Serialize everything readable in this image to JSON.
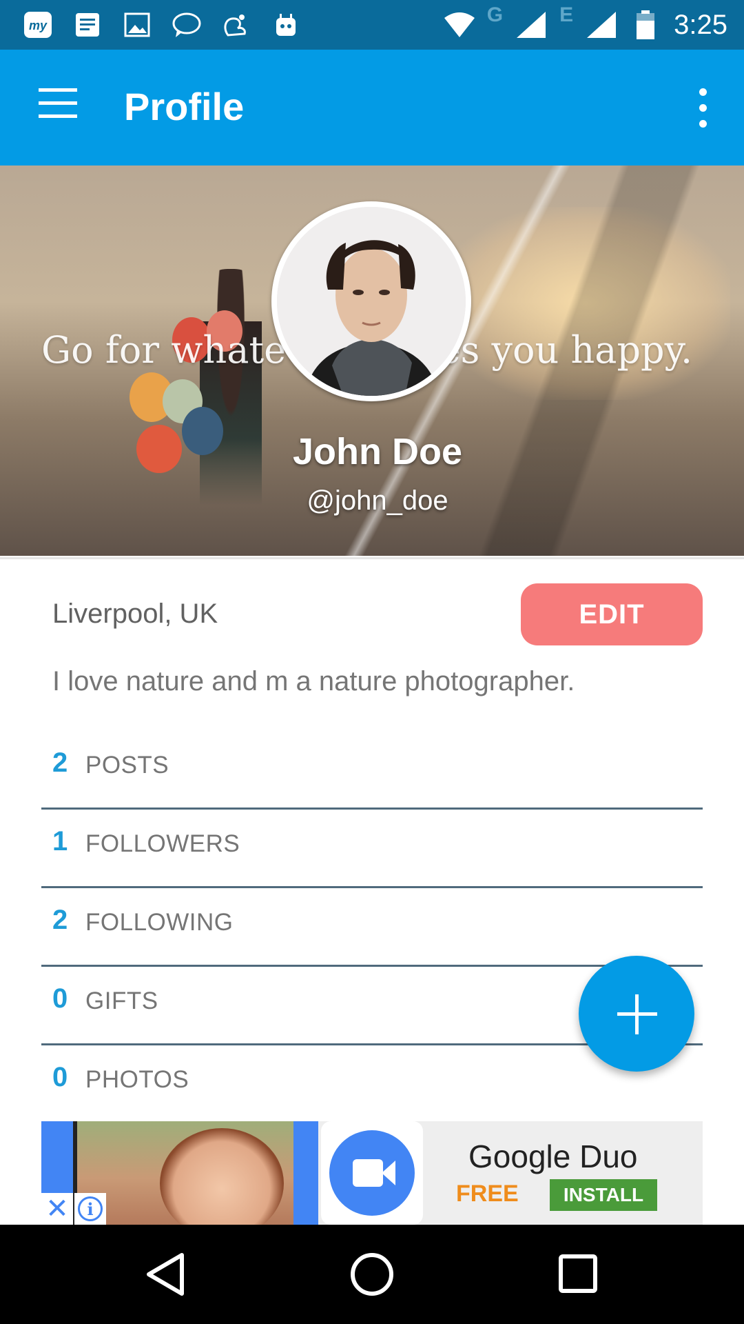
{
  "status_bar": {
    "time": "3:25",
    "network_1": "G",
    "network_2": "E",
    "notification_icons": [
      "my-app-icon",
      "notes-icon",
      "gallery-icon",
      "chat-icon",
      "uc-browser-icon",
      "android-icon"
    ]
  },
  "app_bar": {
    "title": "Profile",
    "menu_icon": "hamburger-icon",
    "overflow_icon": "more-vert-icon"
  },
  "cover": {
    "quote": "Go for whatever makes you happy.",
    "name": "John Doe",
    "handle": "@john_doe"
  },
  "profile": {
    "location": "Liverpool, UK",
    "edit_label": "EDIT",
    "bio": "I love nature and m a nature photographer."
  },
  "stats": [
    {
      "count": "2",
      "label": "POSTS"
    },
    {
      "count": "1",
      "label": "FOLLOWERS"
    },
    {
      "count": "2",
      "label": "FOLLOWING"
    },
    {
      "count": "0",
      "label": "GIFTS"
    },
    {
      "count": "0",
      "label": "PHOTOS"
    }
  ],
  "ad": {
    "title": "Google Duo",
    "price": "FREE",
    "install_label": "INSTALL",
    "close_symbol": "✕"
  },
  "colors": {
    "status_bar": "#0a6b9b",
    "app_bar": "#039be5",
    "edit_button": "#f67b7b",
    "stat_count": "#1e9bd7",
    "divider": "#4f6a7c",
    "fab": "#039be5"
  }
}
